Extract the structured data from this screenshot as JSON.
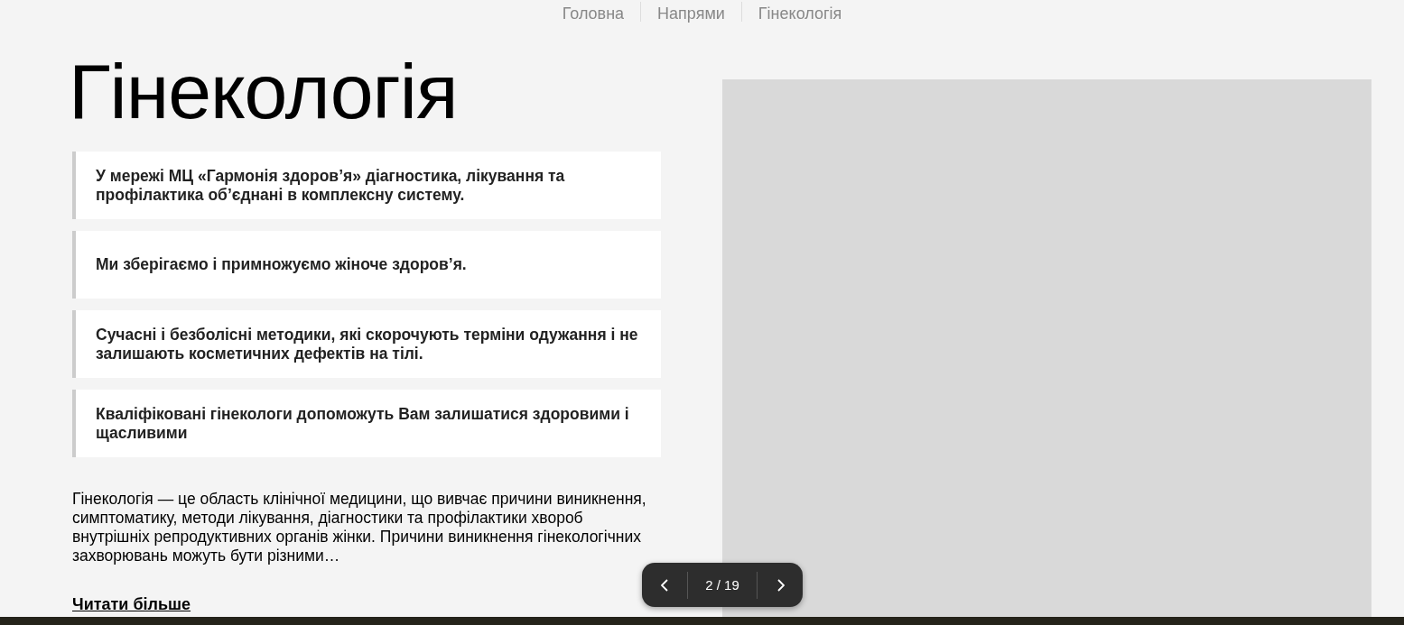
{
  "breadcrumb": [
    {
      "label": "Головна"
    },
    {
      "label": "Напрями"
    },
    {
      "label": "Гінекологія"
    }
  ],
  "title": "Гінекологія",
  "features": [
    {
      "text": "У мережі МЦ «Гармонія здоров’я» діагностика, лікування та профілактика об’єднані в комплексну систему."
    },
    {
      "text": "Ми зберігаємо і примножуємо жіноче здоров’я."
    },
    {
      "text": "Сучасні і безболісні методики, які скорочують терміни одужання і не залишають косметичних дефектів на тілі."
    },
    {
      "text": "Кваліфіковані гінекологи допоможуть Вам залишатися здоровими і щасливими"
    }
  ],
  "description": "Гінекологія — це область клінічної медицини, що вивчає причини виникнення, симптоматику, методи лікування, діагностики та профілактики хвороб внутрішніх репродуктивних органів жінки. Причини виникнення гінекологічних захворювань можуть бути різними…",
  "read_more": "Читати більше",
  "pager": {
    "counter": "2 / 19"
  }
}
